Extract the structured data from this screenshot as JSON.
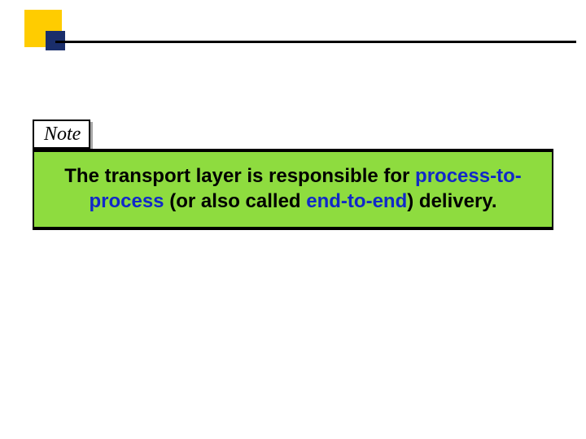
{
  "decor": {
    "square1_color": "#ffcc00",
    "square2_color": "#1a2e6b"
  },
  "note_label": "Note",
  "sentence": {
    "part1": "The transport layer is responsible for ",
    "em1": "process-to-process",
    "part2": " (or also called ",
    "em2": "end-to-end",
    "part3": ") delivery."
  }
}
